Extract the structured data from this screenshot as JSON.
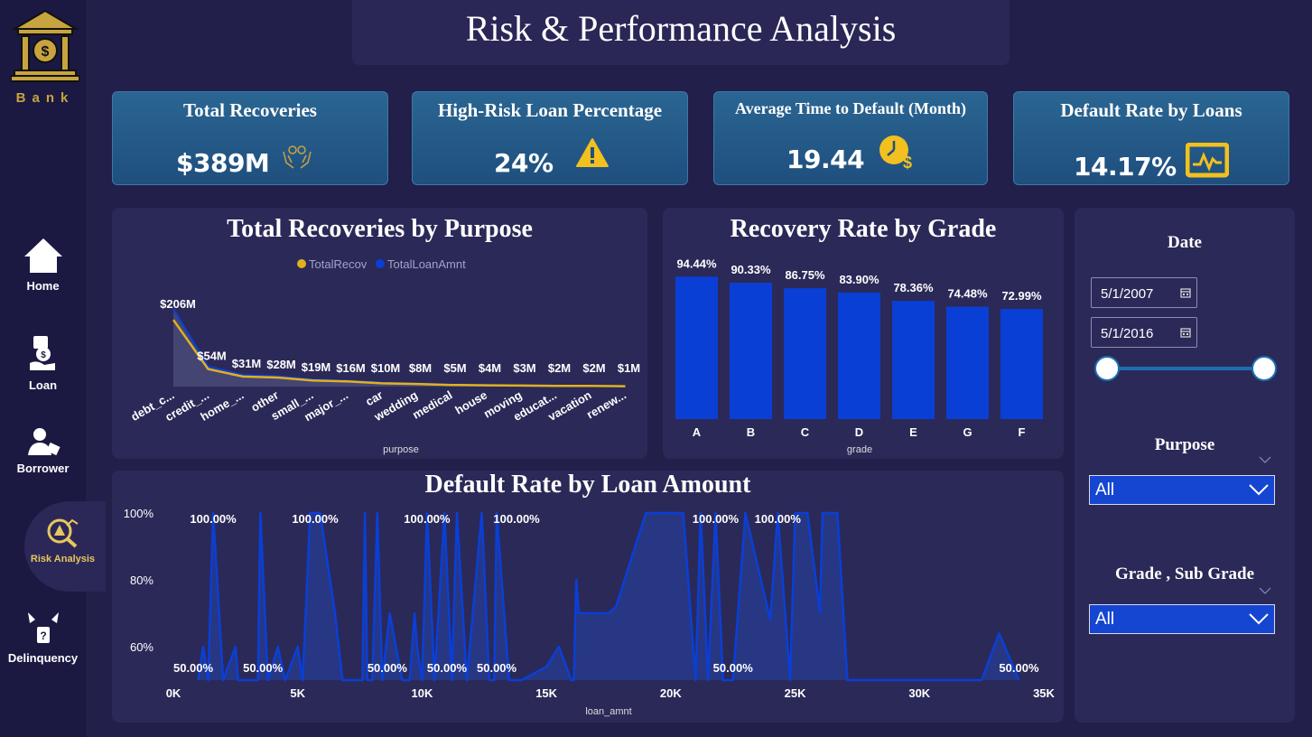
{
  "sidebar": {
    "logo_text": "Bank",
    "items": [
      {
        "label": "Home",
        "icon": "home-icon"
      },
      {
        "label": "Loan",
        "icon": "loan-icon"
      },
      {
        "label": "Borrower",
        "icon": "borrower-icon"
      },
      {
        "label": "Risk Analysis",
        "icon": "risk-analysis-icon",
        "active": true
      },
      {
        "label": "Delinquency",
        "icon": "delinquency-icon"
      }
    ]
  },
  "header": {
    "title": "Risk & Performance Analysis"
  },
  "kpis": [
    {
      "title": "Total Recoveries",
      "value": "$389M",
      "icon": "hands-icon"
    },
    {
      "title": "High-Risk Loan Percentage",
      "value": "24%",
      "icon": "warning-icon"
    },
    {
      "title": "Average Time to Default (Month)",
      "value": "19.44",
      "icon": "clock-dollar-icon"
    },
    {
      "title": "Default Rate by Loans",
      "value": "14.17%",
      "icon": "monitor-chart-icon"
    }
  ],
  "colors": {
    "background": "#221f4a",
    "panel": "#2b2958",
    "bar": "#0a3fd6",
    "line_blue": "#0a3fd6",
    "line_gold": "#e0b020",
    "kpi_card": "#245a88",
    "accent_gold": "#f2c01f"
  },
  "chart_data": [
    {
      "type": "area",
      "title": "Total Recoveries by Purpose",
      "xlabel": "purpose",
      "ylabel": "",
      "legend_position": "top-center",
      "categories": [
        "debt_c...",
        "credit_...",
        "home_...",
        "other",
        "small_...",
        "major_...",
        "car",
        "wedding",
        "medical",
        "house",
        "moving",
        "educat...",
        "vacation",
        "renew..."
      ],
      "series": [
        {
          "name": "TotalRecov",
          "color": "#e0b020",
          "values": [
            206,
            54,
            31,
            28,
            19,
            16,
            10,
            8,
            5,
            4,
            3,
            2,
            2,
            1
          ]
        },
        {
          "name": "TotalLoanAmnt",
          "color": "#0a3fd6",
          "values": [
            240,
            62,
            36,
            32,
            22,
            18,
            12,
            9,
            6,
            5,
            4,
            3,
            2,
            1
          ]
        }
      ],
      "data_labels": [
        "$206M",
        "$54M",
        "$31M",
        "$28M",
        "$19M",
        "$16M",
        "$10M",
        "$8M",
        "$5M",
        "$4M",
        "$3M",
        "$2M",
        "$2M",
        "$1M"
      ]
    },
    {
      "type": "bar",
      "title": "Recovery Rate by Grade",
      "xlabel": "grade",
      "ylabel": "",
      "categories": [
        "A",
        "B",
        "C",
        "D",
        "E",
        "G",
        "F"
      ],
      "values": [
        94.44,
        90.33,
        86.75,
        83.9,
        78.36,
        74.48,
        72.99
      ],
      "data_labels": [
        "94.44%",
        "90.33%",
        "86.75%",
        "83.90%",
        "78.36%",
        "74.48%",
        "72.99%"
      ],
      "ylim": [
        0,
        100
      ]
    },
    {
      "type": "area",
      "title": "Default Rate by Loan Amount",
      "xlabel": "loan_amnt",
      "ylabel": "",
      "xlim": [
        0,
        35000
      ],
      "ylim": [
        50,
        100
      ],
      "x_ticks": [
        "0K",
        "5K",
        "10K",
        "15K",
        "20K",
        "25K",
        "30K",
        "35K"
      ],
      "y_ticks": [
        "60%",
        "80%",
        "100%"
      ],
      "points": [
        [
          1000,
          50
        ],
        [
          1200,
          60
        ],
        [
          1400,
          50
        ],
        [
          1600,
          100
        ],
        [
          2000,
          50
        ],
        [
          2500,
          60
        ],
        [
          2600,
          50
        ],
        [
          3400,
          50
        ],
        [
          3500,
          100
        ],
        [
          3800,
          50
        ],
        [
          4200,
          60
        ],
        [
          4500,
          50
        ],
        [
          5000,
          60
        ],
        [
          5200,
          50
        ],
        [
          5500,
          100
        ],
        [
          5900,
          100
        ],
        [
          6500,
          70
        ],
        [
          6800,
          50
        ],
        [
          7600,
          50
        ],
        [
          7700,
          100
        ],
        [
          7800,
          50
        ],
        [
          8000,
          50
        ],
        [
          8200,
          100
        ],
        [
          8400,
          50
        ],
        [
          8700,
          70
        ],
        [
          9200,
          50
        ],
        [
          9500,
          50
        ],
        [
          9700,
          70
        ],
        [
          9800,
          60
        ],
        [
          10000,
          50
        ],
        [
          10200,
          100
        ],
        [
          10500,
          50
        ],
        [
          10900,
          100
        ],
        [
          11200,
          50
        ],
        [
          11400,
          100
        ],
        [
          11800,
          50
        ],
        [
          12400,
          100
        ],
        [
          12700,
          50
        ],
        [
          12900,
          50
        ],
        [
          13000,
          100
        ],
        [
          13500,
          50
        ],
        [
          14000,
          50
        ],
        [
          15000,
          54
        ],
        [
          15500,
          60
        ],
        [
          16000,
          50
        ],
        [
          16100,
          50
        ],
        [
          16200,
          80
        ],
        [
          16300,
          70
        ],
        [
          17500,
          70
        ],
        [
          17800,
          72
        ],
        [
          19000,
          100
        ],
        [
          20000,
          100
        ],
        [
          20500,
          100
        ],
        [
          21000,
          50
        ],
        [
          21200,
          100
        ],
        [
          21500,
          50
        ],
        [
          21800,
          100
        ],
        [
          22100,
          50
        ],
        [
          22500,
          50
        ],
        [
          23000,
          100
        ],
        [
          24000,
          68
        ],
        [
          24300,
          100
        ],
        [
          24800,
          50
        ],
        [
          25000,
          100
        ],
        [
          25500,
          100
        ],
        [
          26000,
          70
        ],
        [
          26100,
          100
        ],
        [
          26700,
          100
        ],
        [
          27100,
          50
        ],
        [
          29500,
          50
        ],
        [
          31000,
          50
        ],
        [
          32500,
          50
        ],
        [
          33200,
          64
        ],
        [
          34000,
          50
        ]
      ],
      "data_labels": [
        "100.00%",
        "100.00%",
        "100.00%",
        "100.00%",
        "100.00%",
        "100.00%",
        "50.00%",
        "50.00%",
        "50.00%",
        "50.00%",
        "50.00%",
        "50.00%",
        "50.00%"
      ]
    }
  ],
  "filters": {
    "date_label": "Date",
    "date_start": "5/1/2007",
    "date_end": "5/1/2016",
    "purpose_label": "Purpose",
    "purpose_value": "All",
    "grade_label": "Grade , Sub Grade",
    "grade_value": "All"
  }
}
